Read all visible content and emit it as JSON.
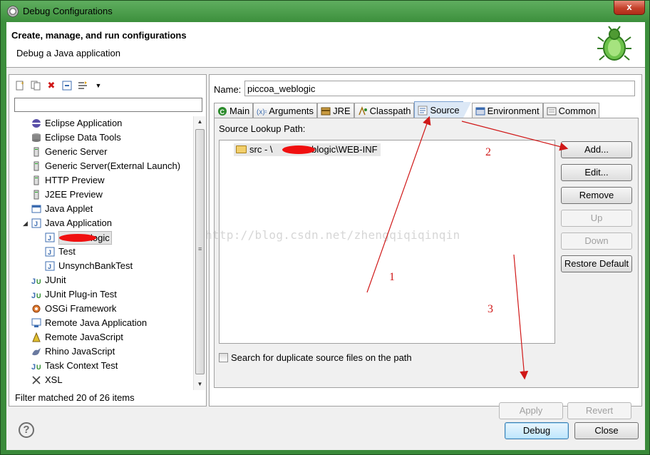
{
  "window": {
    "title": "Debug Configurations",
    "close_label": "x"
  },
  "header": {
    "title": "Create, manage, and run configurations",
    "subtitle": "Debug a Java application"
  },
  "left_panel": {
    "filter_value": "",
    "tree": [
      {
        "label": "Eclipse Application",
        "icon": "eclipse-icon"
      },
      {
        "label": "Eclipse Data Tools",
        "icon": "database-icon"
      },
      {
        "label": "Generic Server",
        "icon": "server-icon"
      },
      {
        "label": "Generic Server(External Launch)",
        "icon": "server-icon"
      },
      {
        "label": "HTTP Preview",
        "icon": "server-icon"
      },
      {
        "label": "J2EE Preview",
        "icon": "server-icon"
      },
      {
        "label": "Java Applet",
        "icon": "applet-icon"
      },
      {
        "label": "Java Application",
        "icon": "java-app-icon",
        "expanded": true
      },
      {
        "label": "logic",
        "icon": "java-file-icon",
        "child": true,
        "selected": true
      },
      {
        "label": "Test",
        "icon": "java-file-icon",
        "child": true
      },
      {
        "label": "UnsynchBankTest",
        "icon": "java-file-icon",
        "child": true
      },
      {
        "label": "JUnit",
        "icon": "junit-icon"
      },
      {
        "label": "JUnit Plug-in Test",
        "icon": "junit-plugin-icon"
      },
      {
        "label": "OSGi Framework",
        "icon": "osgi-icon"
      },
      {
        "label": "Remote Java Application",
        "icon": "remote-java-icon"
      },
      {
        "label": "Remote JavaScript",
        "icon": "remote-js-icon"
      },
      {
        "label": "Rhino JavaScript",
        "icon": "rhino-icon"
      },
      {
        "label": "Task Context Test",
        "icon": "junit-icon"
      },
      {
        "label": "XSL",
        "icon": "xsl-icon"
      }
    ],
    "status": "Filter matched 20 of 26 items"
  },
  "config": {
    "name_label": "Name:",
    "name_value": "piccoa_weblogic",
    "tabs": [
      {
        "label": "Main",
        "icon": "main-tab-icon"
      },
      {
        "label": "Arguments",
        "icon": "arguments-icon"
      },
      {
        "label": "JRE",
        "icon": "jre-icon"
      },
      {
        "label": "Classpath",
        "icon": "classpath-icon"
      },
      {
        "label": "Source",
        "icon": "source-icon",
        "active": true
      },
      {
        "label": "Environment",
        "icon": "environment-icon"
      },
      {
        "label": "Common",
        "icon": "common-icon"
      }
    ],
    "source_lookup_label": "Source Lookup Path:",
    "source_item": {
      "prefix": "src - \\",
      "suffix": "weblogic\\WEB-INF"
    },
    "buttons": {
      "add": "Add...",
      "edit": "Edit...",
      "remove": "Remove",
      "up": "Up",
      "down": "Down",
      "restore": "Restore Default"
    },
    "search_duplicates_label": "Search for duplicate source files on the path",
    "apply": "Apply",
    "revert": "Revert"
  },
  "footer": {
    "debug": "Debug",
    "close": "Close"
  },
  "watermark": "http://blog.csdn.net/zhengqiqiqinqin",
  "annotations": {
    "one": "1",
    "two": "2",
    "three": "3"
  },
  "colors": {
    "annotation": "#d01818",
    "window_frame": "#3c8f3c"
  }
}
